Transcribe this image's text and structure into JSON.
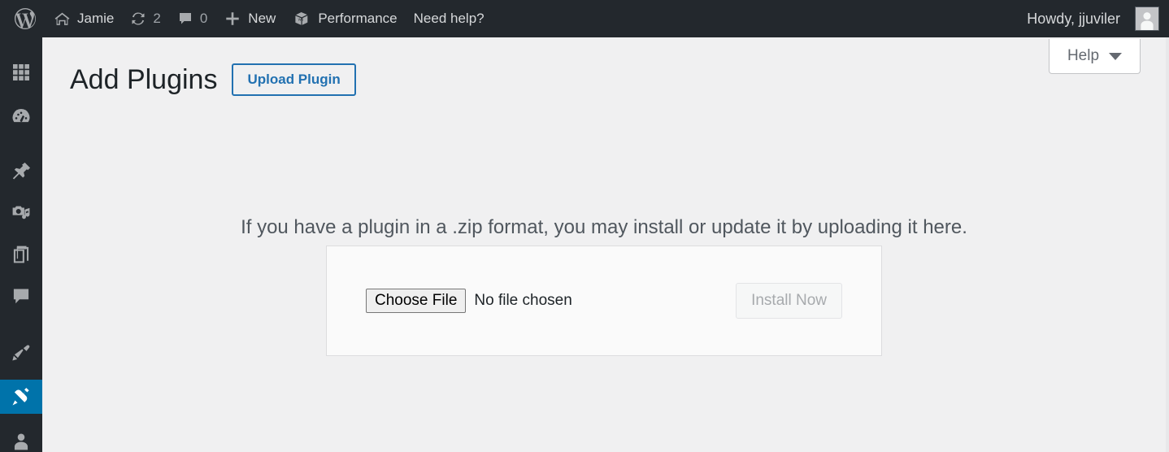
{
  "colors": {
    "adminbar_bg": "#23282d",
    "sidebar_bg": "#23282d",
    "content_bg": "#f0f0f1",
    "accent_blue": "#2271b1",
    "current_menu_bg": "#0073aa",
    "box_bg": "#fafafa",
    "box_border": "#dcdcde"
  },
  "adminbar": {
    "logo_icon": "wordpress-logo-icon",
    "site_name": "Jamie",
    "site_icon": "home-icon",
    "updates_count": "2",
    "updates_icon": "updates-sync-icon",
    "comments_count": "0",
    "comments_icon": "comment-bubble-icon",
    "new_label": "New",
    "new_icon": "plus-icon",
    "performance_label": "Performance",
    "performance_icon": "w3-cache-box-icon",
    "need_help_label": "Need help?",
    "howdy_label": "Howdy, jjuviler",
    "avatar_icon": "user-avatar-icon"
  },
  "sidebar": {
    "items": [
      {
        "name": "menu-toggle",
        "icon": "grid-menu-icon",
        "current": false
      },
      {
        "name": "dashboard",
        "icon": "dashboard-gauge-icon",
        "current": false
      },
      {
        "name": "posts",
        "icon": "pin-icon",
        "current": false
      },
      {
        "name": "media",
        "icon": "camera-music-icon",
        "current": false
      },
      {
        "name": "pages",
        "icon": "pages-stack-icon",
        "current": false
      },
      {
        "name": "comments",
        "icon": "comment-bubble-icon",
        "current": false
      },
      {
        "name": "appearance",
        "icon": "paintbrush-icon",
        "current": false
      },
      {
        "name": "plugins",
        "icon": "plug-icon",
        "current": true
      },
      {
        "name": "users",
        "icon": "user-icon",
        "current": false
      }
    ]
  },
  "screen_meta": {
    "help_label": "Help",
    "help_caret_icon": "chevron-down-icon"
  },
  "main": {
    "page_title": "Add Plugins",
    "upload_plugin_button": "Upload Plugin",
    "upload_intro": "If you have a plugin in a .zip format, you may install or update it by uploading it here.",
    "choose_file_label": "Choose File",
    "no_file_chosen": "No file chosen",
    "install_now_label": "Install Now"
  }
}
